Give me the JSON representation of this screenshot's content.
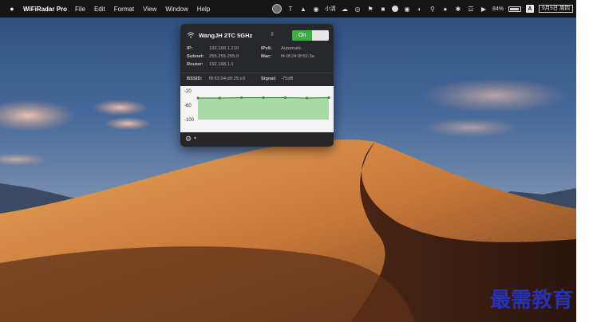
{
  "menubar": {
    "apple_icon": "apple-logo",
    "app_name": "WiFiRadar Pro",
    "menus": [
      "File",
      "Edit",
      "Format",
      "View",
      "Window",
      "Help"
    ],
    "status_text_1": "小清",
    "battery_percent": "84%",
    "input_source": "A",
    "date": "9月5日 周四"
  },
  "wifi": {
    "network_name": "WangJH 2TC 5GHz",
    "toggle_label": "On",
    "ip_label": "IP:",
    "ip_value": "192.168.1.210",
    "ipv6_label": "IPv6:",
    "ipv6_value": "Automatic",
    "subnet_label": "Subnet:",
    "subnet_value": "255.255.255.0",
    "mac_label": "Mac:",
    "mac_value": "f4:0f:24:0f:52:3a",
    "router_label": "Router:",
    "router_value": "192.168.1.1",
    "bssid_label": "BSSID:",
    "bssid_value": "f8:63:94:d0:25:e3",
    "signal_label": "Signal:",
    "signal_value": "-75dB"
  },
  "chart_data": {
    "type": "area",
    "title": "",
    "xlabel": "",
    "ylabel": "",
    "y_ticks": [
      "-20",
      "-60",
      "-100"
    ],
    "ylim": [
      -100,
      -20
    ],
    "x": [
      1,
      2,
      3,
      4,
      5,
      6,
      7
    ],
    "series": [
      {
        "values": [
          -40,
          -40,
          -39,
          -39,
          -39,
          -40,
          -39
        ]
      }
    ],
    "colors": {
      "line": "#3e8a3e",
      "fill": "#a9d9a4"
    },
    "grid": false,
    "legend": "none"
  },
  "watermark": "最需教育"
}
